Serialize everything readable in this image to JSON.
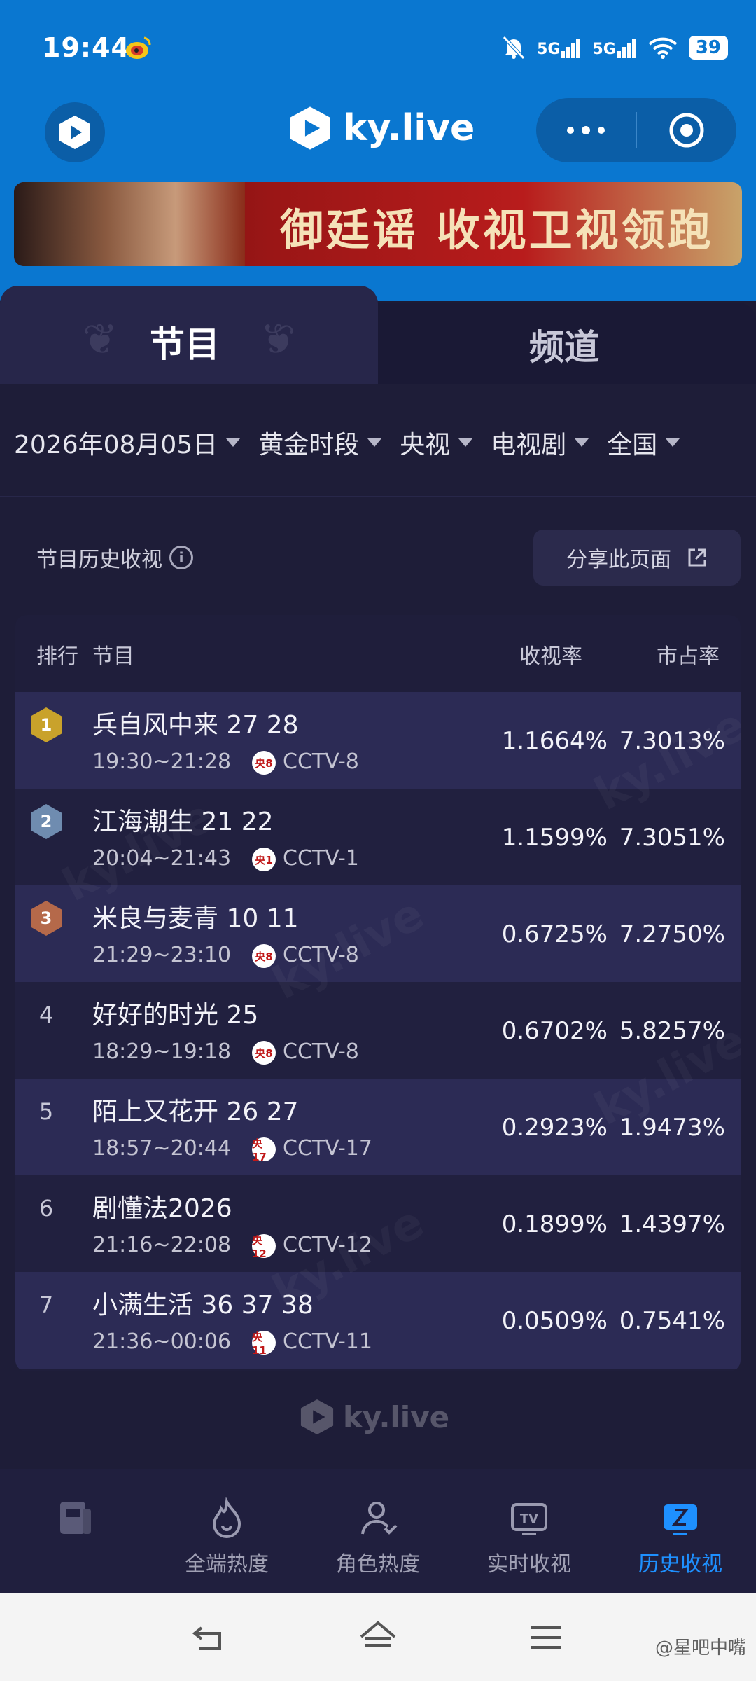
{
  "status": {
    "time": "19:44",
    "signal1": "5G",
    "signal2": "5G",
    "battery": "39"
  },
  "header": {
    "brand": "ky.live"
  },
  "banner": {
    "text": "御廷谣 收视卫视领跑"
  },
  "tabs": [
    {
      "label": "节目",
      "active": true
    },
    {
      "label": "频道",
      "active": false
    }
  ],
  "filters": [
    {
      "label": "2026年08月05日"
    },
    {
      "label": "黄金时段"
    },
    {
      "label": "央视"
    },
    {
      "label": "电视剧"
    },
    {
      "label": "全国"
    }
  ],
  "section": {
    "title": "节目历史收视",
    "share_button": "分享此页面"
  },
  "table": {
    "headers": {
      "rank": "排行",
      "program": "节目",
      "rating": "收视率",
      "share": "市占率"
    },
    "rows": [
      {
        "rank": "1",
        "title": "兵自风中来 27 28",
        "time": "19:30~21:28",
        "logo": "央8",
        "channel": "CCTV-8",
        "rating": "1.1664%",
        "share": "7.3013%"
      },
      {
        "rank": "2",
        "title": "江海潮生 21 22",
        "time": "20:04~21:43",
        "logo": "央1",
        "channel": "CCTV-1",
        "rating": "1.1599%",
        "share": "7.3051%"
      },
      {
        "rank": "3",
        "title": "米良与麦青 10 11",
        "time": "21:29~23:10",
        "logo": "央8",
        "channel": "CCTV-8",
        "rating": "0.6725%",
        "share": "7.2750%"
      },
      {
        "rank": "4",
        "title": "好好的时光 25",
        "time": "18:29~19:18",
        "logo": "央8",
        "channel": "CCTV-8",
        "rating": "0.6702%",
        "share": "5.8257%"
      },
      {
        "rank": "5",
        "title": "陌上又花开 26 27",
        "time": "18:57~20:44",
        "logo": "央17",
        "channel": "CCTV-17",
        "rating": "0.2923%",
        "share": "1.9473%"
      },
      {
        "rank": "6",
        "title": "剧懂法2026",
        "time": "21:16~22:08",
        "logo": "央12",
        "channel": "CCTV-12",
        "rating": "0.1899%",
        "share": "1.4397%"
      },
      {
        "rank": "7",
        "title": "小满生活 36 37 38",
        "time": "21:36~00:06",
        "logo": "央11",
        "channel": "CCTV-11",
        "rating": "0.0509%",
        "share": "0.7541%"
      }
    ]
  },
  "watermark": "ky.live",
  "bottom_nav": [
    {
      "label": "",
      "icon": "news-icon",
      "active": false
    },
    {
      "label": "全端热度",
      "icon": "fire-icon",
      "active": false
    },
    {
      "label": "角色热度",
      "icon": "person-icon",
      "active": false
    },
    {
      "label": "实时收视",
      "icon": "tv-icon",
      "active": false
    },
    {
      "label": "历史收视",
      "icon": "history-icon",
      "active": true
    }
  ],
  "credit": "@星吧中嘴",
  "colors": {
    "primary_blue": "#0a77d0",
    "panel_bg": "#1e1d38",
    "active_nav": "#1e90ff",
    "gold": "#c9a22b",
    "silver": "#6f8cb0",
    "bronze": "#b5694a"
  }
}
